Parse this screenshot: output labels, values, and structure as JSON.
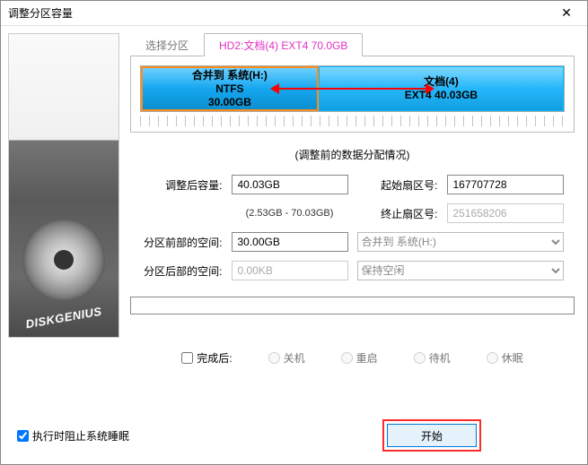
{
  "window": {
    "title": "调整分区容量"
  },
  "sidebar": {
    "brand": "DISKGENIUS"
  },
  "tabs": {
    "choose": "选择分区",
    "selected": "HD2:文档(4) EXT4 70.0GB"
  },
  "diagram": {
    "left": {
      "line1": "合并到 系统(H:)",
      "line2": "NTFS",
      "line3": "30.00GB"
    },
    "right": {
      "line1": "文档(4)",
      "line2": "EXT4 40.03GB"
    }
  },
  "caption": "(调整前的数据分配情况)",
  "form": {
    "size_after_label": "调整后容量:",
    "size_after_value": "40.03GB",
    "size_range": "(2.53GB - 70.03GB)",
    "start_sector_label": "起始扇区号:",
    "start_sector_value": "167707728",
    "end_sector_label": "终止扇区号:",
    "end_sector_value": "251658206",
    "front_space_label": "分区前部的空间:",
    "front_space_value": "30.00GB",
    "front_select": "合并到 系统(H:)",
    "back_space_label": "分区后部的空间:",
    "back_space_value": "0.00KB",
    "back_select": "保持空闲"
  },
  "after": {
    "label": "完成后:",
    "shutdown": "关机",
    "reboot": "重启",
    "standby": "待机",
    "hibernate": "休眠"
  },
  "footer": {
    "prevent_sleep": "执行时阻止系统睡眠",
    "start": "开始"
  }
}
